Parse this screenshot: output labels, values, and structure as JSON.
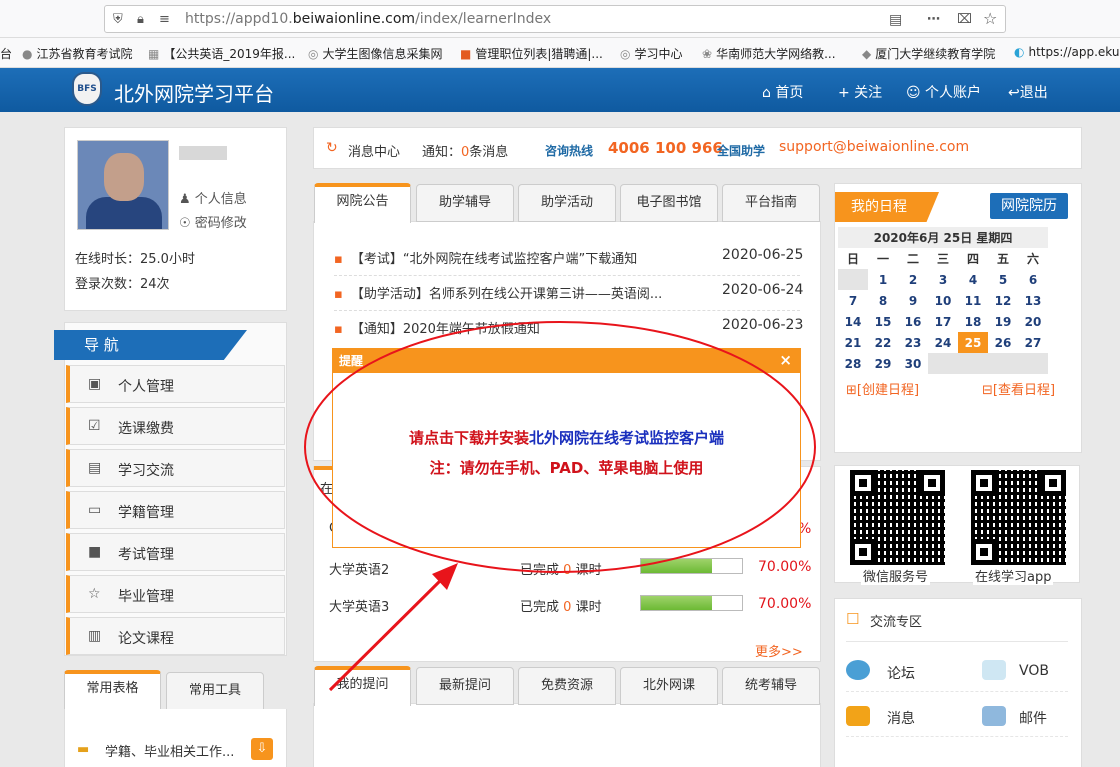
{
  "browser": {
    "url_prefix": "https://appd10.",
    "url_domain": "beiwaionline.com",
    "url_path": "/index/learnerIndex"
  },
  "bookmarks": [
    "台",
    "江苏省教育考试院",
    "【公共英语_2019年报...",
    "大学生图像信息采集网",
    "管理职位列表|猎聘通|...",
    "学习中心",
    "华南师范大学网络教...",
    "厦门大学继续教育学院",
    "https://app.eku"
  ],
  "header": {
    "logo_text": "BFS",
    "title": "北外网院学习平台",
    "links": [
      "首页",
      "+ 关注",
      "个人账户",
      "退出"
    ]
  },
  "user": {
    "name_masked": "",
    "info_link": "个人信息",
    "pwd_link": "密码修改",
    "online_time": "在线时长：25.0小时",
    "login_count": "登录次数：24次"
  },
  "message_bar": {
    "center": "消息中心",
    "notice_prefix": "通知：",
    "notice_count": "0",
    "notice_suffix": "条消息",
    "hotline_label": "咨询热线",
    "hotline": "4006 100 966",
    "help_label": "全国助学",
    "email": "support@beiwaionline.com"
  },
  "nav": {
    "title": "导 航",
    "items": [
      "个人管理",
      "选课缴费",
      "学习交流",
      "学籍管理",
      "考试管理",
      "毕业管理",
      "论文课程"
    ]
  },
  "news_tabs": [
    "网院公告",
    "助学辅导",
    "助学活动",
    "电子图书馆",
    "平台指南"
  ],
  "news": [
    {
      "title": "【考试】“北外网院在线考试监控客户端”下载通知",
      "date": "2020-06-25"
    },
    {
      "title": "【助学活动】名师系列在线公开课第三讲——英语阅...",
      "date": "2020-06-24"
    },
    {
      "title": "【通知】2020年端午节放假通知",
      "date": "2020-06-23"
    }
  ],
  "courses": {
    "partial_label": "在",
    "partial_left": "C",
    "partial_right": "%",
    "items": [
      {
        "name": "大学英语2",
        "done_prefix": "已完成",
        "done_count": "0",
        "done_suffix": "课时",
        "progress": 70,
        "percent": "70.00%"
      },
      {
        "name": "大学英语3",
        "done_prefix": "已完成",
        "done_count": "0",
        "done_suffix": "课时",
        "progress": 70,
        "percent": "70.00%"
      }
    ],
    "more": "更多>>"
  },
  "bottom_tabs": [
    "我的提问",
    "最新提问",
    "免费资源",
    "北外网课",
    "统考辅导"
  ],
  "left_bottom_tabs": [
    "常用表格",
    "常用工具"
  ],
  "left_bottom_item": "学籍、毕业相关工作...",
  "schedule": {
    "title": "我的日程",
    "calendar_btn": "网院院历",
    "date_title": "2020年6月 25日 星期四",
    "weekdays": [
      "日",
      "一",
      "二",
      "三",
      "四",
      "五",
      "六"
    ],
    "weeks": [
      [
        "",
        "1",
        "2",
        "3",
        "4",
        "5",
        "6"
      ],
      [
        "7",
        "8",
        "9",
        "10",
        "11",
        "12",
        "13"
      ],
      [
        "14",
        "15",
        "16",
        "17",
        "18",
        "19",
        "20"
      ],
      [
        "21",
        "22",
        "23",
        "24",
        "25",
        "26",
        "27"
      ],
      [
        "28",
        "29",
        "30",
        "",
        "",
        "",
        ""
      ]
    ],
    "today": "25",
    "create": "[创建日程]",
    "view": "[查看日程]"
  },
  "qr": {
    "left_label": "微信服务号",
    "right_label": "在线学习app"
  },
  "exchange": {
    "title": "交流专区",
    "items": [
      "论坛",
      "VOB",
      "消息",
      "邮件"
    ]
  },
  "modal": {
    "title": "提醒",
    "close": "×",
    "line1_prefix": "请点击下载并安装",
    "line1_link": "北外网院在线考试监控客户端",
    "line2": "注：请勿在手机、PAD、苹果电脑上使用"
  },
  "colors": {
    "primary_blue": "#1d6eb8",
    "accent_orange": "#f7941d",
    "alert_red": "#d0121b",
    "annotation_red": "#e8141b"
  }
}
